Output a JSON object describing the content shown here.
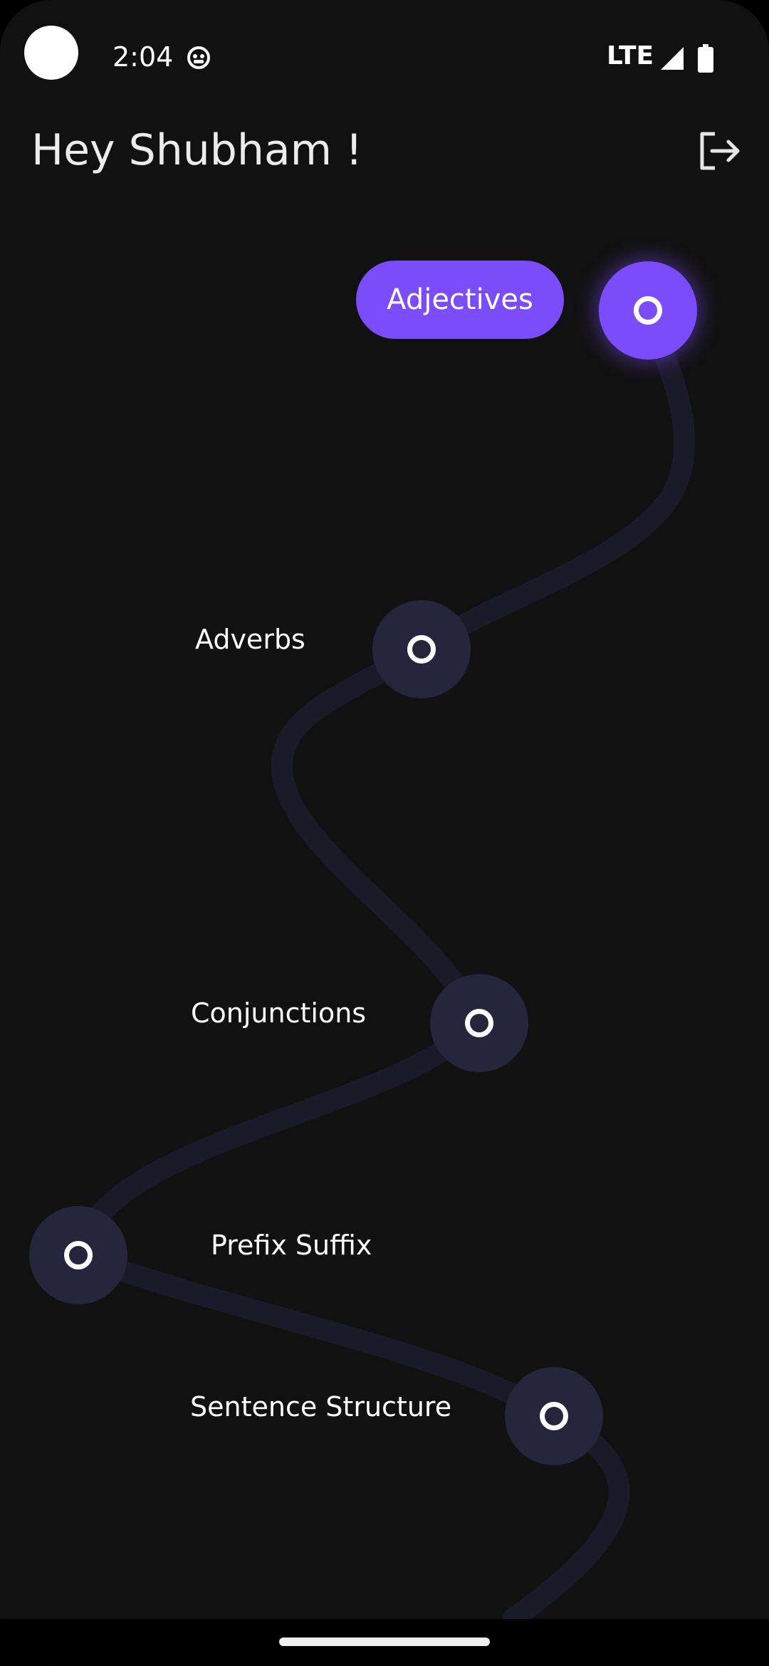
{
  "status_bar": {
    "time": "2:04",
    "network": "LTE",
    "icons": [
      "camera-dot",
      "notification-icon",
      "signal-icon",
      "battery-icon"
    ]
  },
  "header": {
    "greeting": "Hey Shubham !",
    "logout_icon": "logout-icon"
  },
  "levels": [
    {
      "label": "Adjectives",
      "active": true
    },
    {
      "label": "Adverbs",
      "active": false
    },
    {
      "label": "Conjunctions",
      "active": false
    },
    {
      "label": "Prefix Suffix",
      "active": false
    },
    {
      "label": "Sentence Structure",
      "active": false
    }
  ],
  "colors": {
    "background": "#111111",
    "accent": "#7b4dfa",
    "node_inactive": "#25253c",
    "path": "#1b1a28",
    "text": "#ffffff"
  }
}
